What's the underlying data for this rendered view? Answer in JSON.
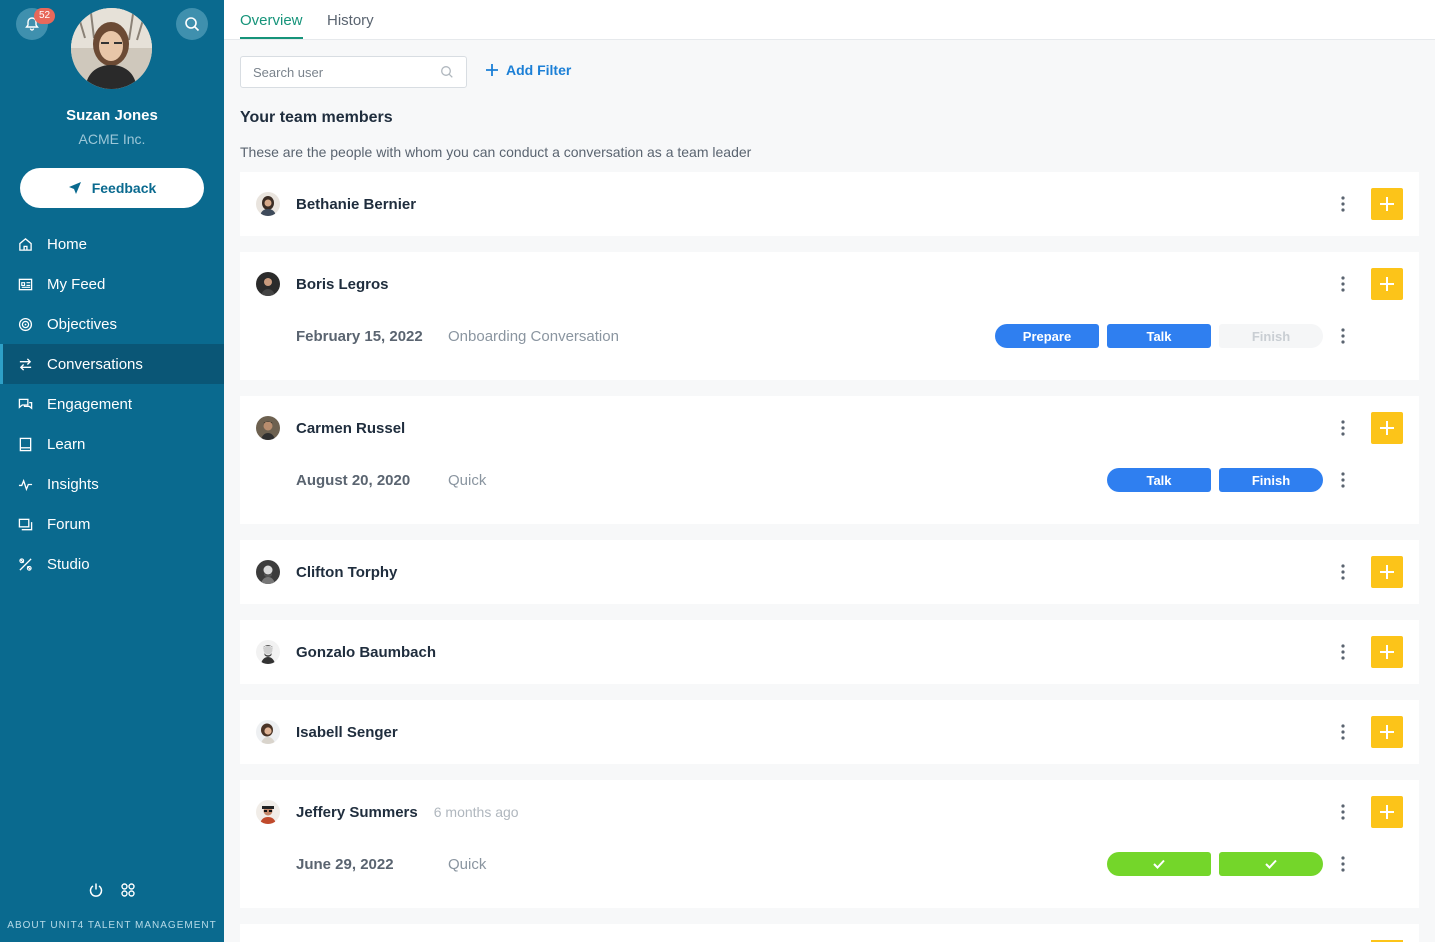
{
  "sidebar": {
    "notification_count": "52",
    "user_name": "Suzan Jones",
    "company": "ACME Inc.",
    "feedback_label": "Feedback",
    "nav": [
      {
        "label": "Home",
        "icon": "home-icon"
      },
      {
        "label": "My Feed",
        "icon": "feed-icon"
      },
      {
        "label": "Objectives",
        "icon": "target-icon"
      },
      {
        "label": "Conversations",
        "icon": "swap-icon",
        "active": true
      },
      {
        "label": "Engagement",
        "icon": "chat-icon"
      },
      {
        "label": "Learn",
        "icon": "book-icon"
      },
      {
        "label": "Insights",
        "icon": "pulse-icon"
      },
      {
        "label": "Forum",
        "icon": "forum-icon"
      },
      {
        "label": "Studio",
        "icon": "studio-icon"
      }
    ],
    "about": "ABOUT UNIT4 TALENT MANAGEMENT"
  },
  "tabs": [
    {
      "label": "Overview",
      "active": true
    },
    {
      "label": "History"
    }
  ],
  "search": {
    "placeholder": "Search user"
  },
  "add_filter_label": "Add Filter",
  "section": {
    "title": "Your team members",
    "subtitle": "These are the people with whom you can conduct a conversation as a team leader"
  },
  "members": [
    {
      "name": "Bethanie Bernier"
    },
    {
      "name": "Boris Legros",
      "conversation": {
        "date": "February 15, 2022",
        "type": "Onboarding Conversation",
        "steps": [
          "Prepare",
          "Talk",
          "Finish"
        ]
      }
    },
    {
      "name": "Carmen Russel",
      "conversation": {
        "date": "August 20, 2020",
        "type": "Quick",
        "steps": [
          "Talk",
          "Finish"
        ]
      }
    },
    {
      "name": "Clifton Torphy"
    },
    {
      "name": "Gonzalo Baumbach"
    },
    {
      "name": "Isabell Senger"
    },
    {
      "name": "Jeffery Summers",
      "ago": "6 months ago",
      "conversation": {
        "date": "June 29, 2022",
        "type": "Quick",
        "steps": [
          "done",
          "done"
        ]
      }
    }
  ],
  "colors": {
    "sidebar": "#0a6a8f",
    "accent": "#16947a",
    "primary_button": "#2f7ff0",
    "add_button": "#fcc419",
    "done": "#74d62a"
  }
}
